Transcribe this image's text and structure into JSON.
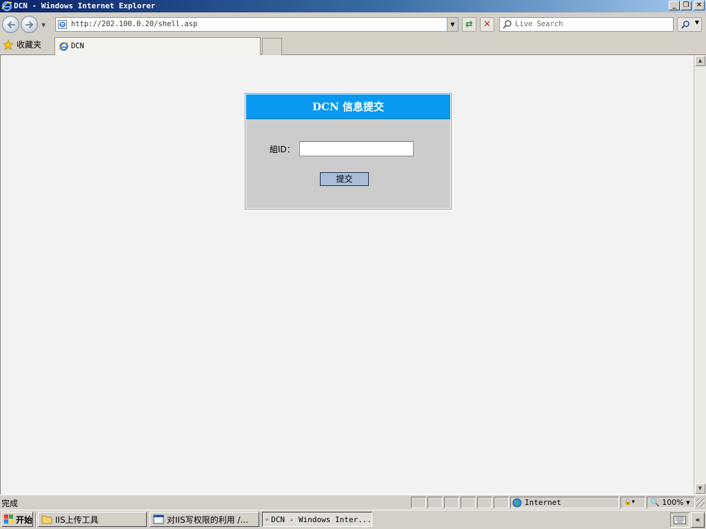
{
  "window": {
    "title": "DCN - Windows Internet Explorer",
    "min_icon": "minimize-icon",
    "max_icon": "restore-icon",
    "close_icon": "close-icon"
  },
  "nav": {
    "url": "http://202.100.0.20/shell.asp",
    "search_placeholder": "Live Search"
  },
  "tabs": {
    "favorites_label": "收藏夹",
    "active_tab": "DCN"
  },
  "form": {
    "header": "DCN 信息提交",
    "field_label": "組ID：",
    "field_value": "",
    "submit_label": "提交",
    "header_color": "#0a99f0"
  },
  "status": {
    "text": "完成",
    "zone": "Internet",
    "zoom": "100%"
  },
  "taskbar": {
    "start_label": "开始",
    "tasks": [
      {
        "label": "IIS上传工具"
      },
      {
        "label": "对IIS写权限的利用 /..."
      },
      {
        "label": "DCN - Windows Inter..."
      }
    ]
  }
}
